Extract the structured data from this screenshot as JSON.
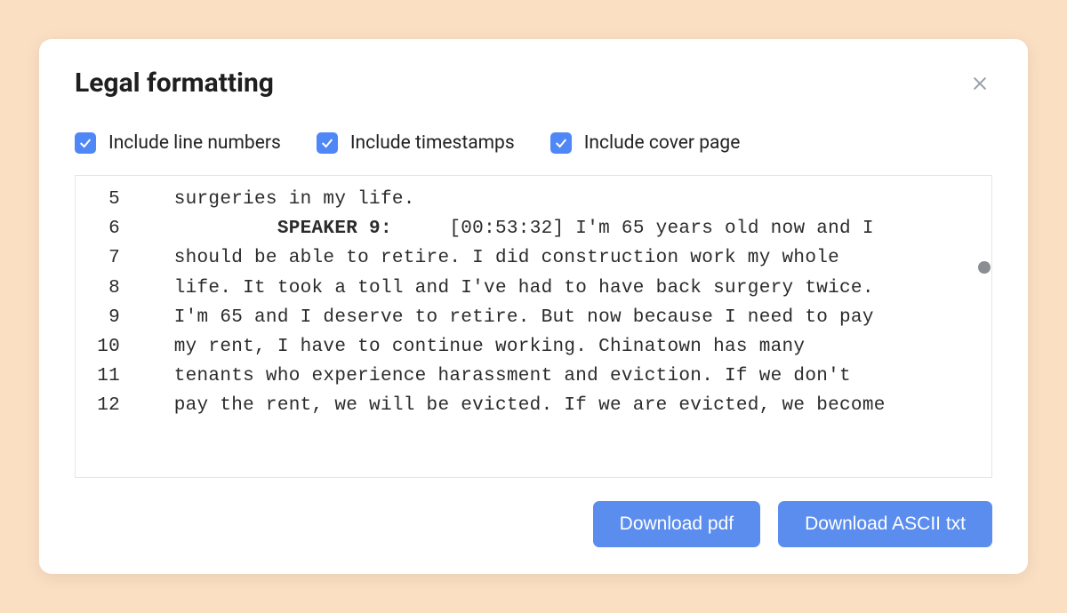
{
  "modal": {
    "title": "Legal formatting",
    "options": [
      {
        "label": "Include line numbers",
        "checked": true
      },
      {
        "label": "Include timestamps",
        "checked": true
      },
      {
        "label": "Include cover page",
        "checked": true
      }
    ],
    "buttons": {
      "pdf": "Download pdf",
      "ascii": "Download ASCII txt"
    }
  },
  "transcript": {
    "indent_body": "   ",
    "indent_speaker": "            ",
    "lines": [
      {
        "num": "5",
        "text": "surgeries in my life."
      },
      {
        "num": "6",
        "speaker": "SPEAKER 9:",
        "post_speaker": "     ",
        "timestamp": "[00:53:32]",
        "text": " I'm 65 years old now and I"
      },
      {
        "num": "7",
        "text": "should be able to retire. I did construction work my whole"
      },
      {
        "num": "8",
        "text": "life. It took a toll and I've had to have back surgery twice."
      },
      {
        "num": "9",
        "text": "I'm 65 and I deserve to retire. But now because I need to pay"
      },
      {
        "num": "10",
        "text": "my rent, I have to continue working. Chinatown has many"
      },
      {
        "num": "11",
        "text": "tenants who experience harassment and eviction. If we don't"
      },
      {
        "num": "12",
        "text": "pay the rent, we will be evicted. If we are evicted, we become"
      }
    ]
  },
  "colors": {
    "accent": "#4f87f7",
    "background": "#fbdfc3"
  }
}
